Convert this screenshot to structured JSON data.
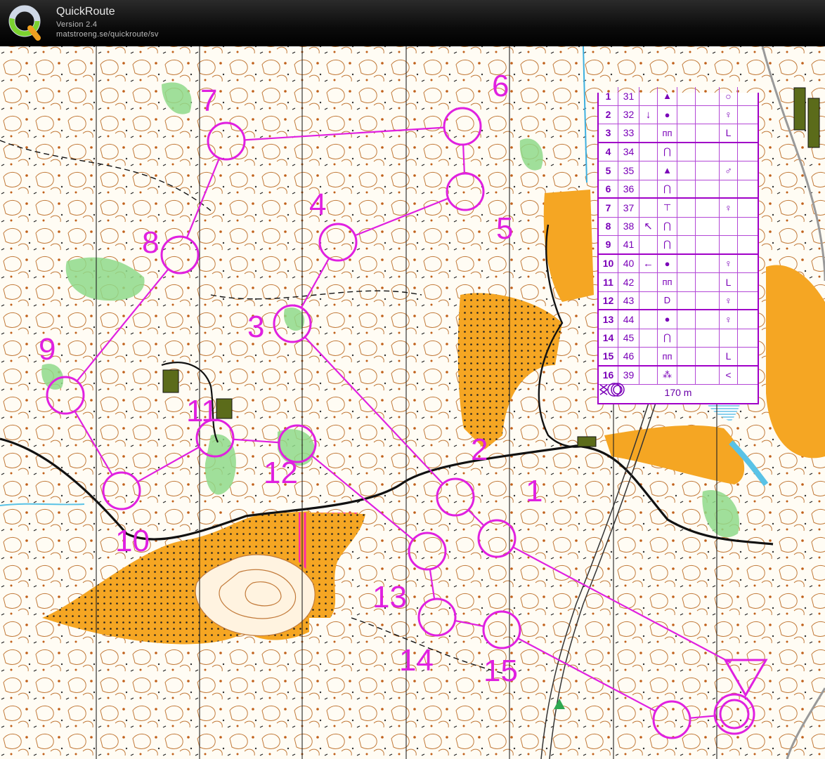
{
  "app": {
    "title": "QuickRoute",
    "version": "Version 2.4",
    "url": "matstroeng.se/quickroute/sv"
  },
  "colors": {
    "course": "#e020e0",
    "contour": "#b5651d",
    "open_land": "#f5a623",
    "vegetation": "#8fd98a",
    "water": "#59c2e6",
    "descriptions": "#a000c8"
  },
  "course": {
    "length_label": "170 m",
    "controls": [
      {
        "label": "1"
      },
      {
        "label": "2"
      },
      {
        "label": "3"
      },
      {
        "label": "4"
      },
      {
        "label": "5"
      },
      {
        "label": "6"
      },
      {
        "label": "7"
      },
      {
        "label": "8"
      },
      {
        "label": "9"
      },
      {
        "label": "10"
      },
      {
        "label": "11"
      },
      {
        "label": "12"
      },
      {
        "label": "13"
      },
      {
        "label": "14"
      },
      {
        "label": "15"
      }
    ]
  },
  "descriptions": [
    {
      "num": "1",
      "code": "31",
      "dir": "",
      "feat": "▲",
      "g": "○"
    },
    {
      "num": "2",
      "code": "32",
      "dir": "↓",
      "feat": "●",
      "g": "♀"
    },
    {
      "num": "3",
      "code": "33",
      "dir": "",
      "feat": "ᴨᴨ",
      "g": "L"
    },
    {
      "num": "4",
      "code": "34",
      "dir": "",
      "feat": "⋂",
      "g": ""
    },
    {
      "num": "5",
      "code": "35",
      "dir": "",
      "feat": "▲",
      "g": "♂"
    },
    {
      "num": "6",
      "code": "36",
      "dir": "",
      "feat": "⋂",
      "g": ""
    },
    {
      "num": "7",
      "code": "37",
      "dir": "",
      "feat": "⊤",
      "g": "♀"
    },
    {
      "num": "8",
      "code": "38",
      "dir": "↖",
      "feat": "⋂",
      "g": ""
    },
    {
      "num": "9",
      "code": "41",
      "dir": "",
      "feat": "⋂",
      "g": ""
    },
    {
      "num": "10",
      "code": "40",
      "dir": "←",
      "feat": "●",
      "g": "♀"
    },
    {
      "num": "11",
      "code": "42",
      "dir": "",
      "feat": "ᴨᴨ",
      "g": "L"
    },
    {
      "num": "12",
      "code": "43",
      "dir": "",
      "feat": "D",
      "g": "♀"
    },
    {
      "num": "13",
      "code": "44",
      "dir": "",
      "feat": "●",
      "g": "♀"
    },
    {
      "num": "14",
      "code": "45",
      "dir": "",
      "feat": "⋂",
      "g": ""
    },
    {
      "num": "15",
      "code": "46",
      "dir": "",
      "feat": "ᴨᴨ",
      "g": "L"
    },
    {
      "num": "16",
      "code": "39",
      "dir": "",
      "feat": "⁂",
      "g": "<"
    }
  ]
}
